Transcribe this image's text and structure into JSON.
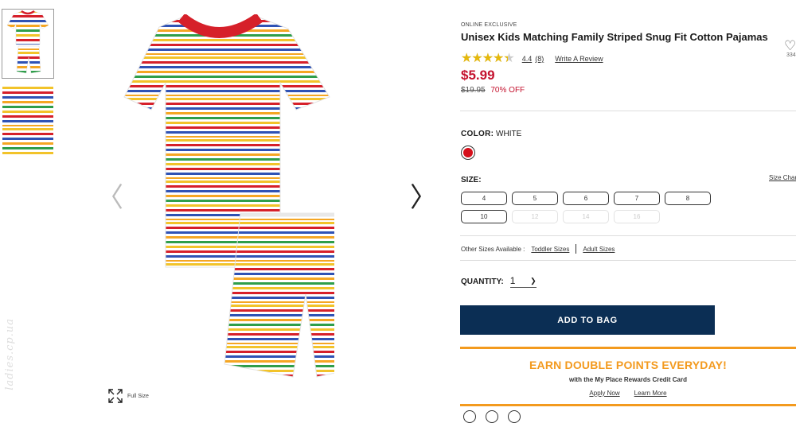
{
  "product": {
    "badge": "ONLINE EXCLUSIVE",
    "title": "Unisex Kids Matching Family Striped Snug Fit Cotton Pajamas",
    "favorites_count": "334",
    "rating_value": "4.4",
    "rating_fraction": 0.88,
    "review_count": "(8)",
    "write_review": "Write A Review",
    "price": "$5.99",
    "original_price": "$19.95",
    "discount": "70% OFF"
  },
  "color": {
    "label": "COLOR:",
    "selected": "WHITE",
    "swatch_color": "#d50f1b"
  },
  "size": {
    "label": "SIZE:",
    "chart_link": "Size Chart",
    "options": [
      {
        "label": "4",
        "available": true
      },
      {
        "label": "5",
        "available": true
      },
      {
        "label": "6",
        "available": true
      },
      {
        "label": "7",
        "available": true
      },
      {
        "label": "8",
        "available": true
      },
      {
        "label": "10",
        "available": true
      },
      {
        "label": "12",
        "available": false
      },
      {
        "label": "14",
        "available": false
      },
      {
        "label": "16",
        "available": false
      }
    ],
    "other_label": "Other Sizes Available :",
    "toddler_link": "Toddler Sizes",
    "adult_link": "Adult Sizes"
  },
  "quantity": {
    "label": "QUANTITY:",
    "value": "1"
  },
  "add_to_bag": "ADD TO BAG",
  "promo": {
    "headline": "EARN DOUBLE POINTS EVERYDAY!",
    "subline": "with the My Place Rewards Credit Card",
    "apply": "Apply Now",
    "learn": "Learn More",
    "accent": "#f39a1e"
  },
  "gallery": {
    "full_size": "Full Size",
    "watermark": "ladies.cp.ua"
  },
  "colors": {
    "price_red": "#c4122e",
    "button_navy": "#0b2e54",
    "star_gold": "#e5b80b"
  }
}
